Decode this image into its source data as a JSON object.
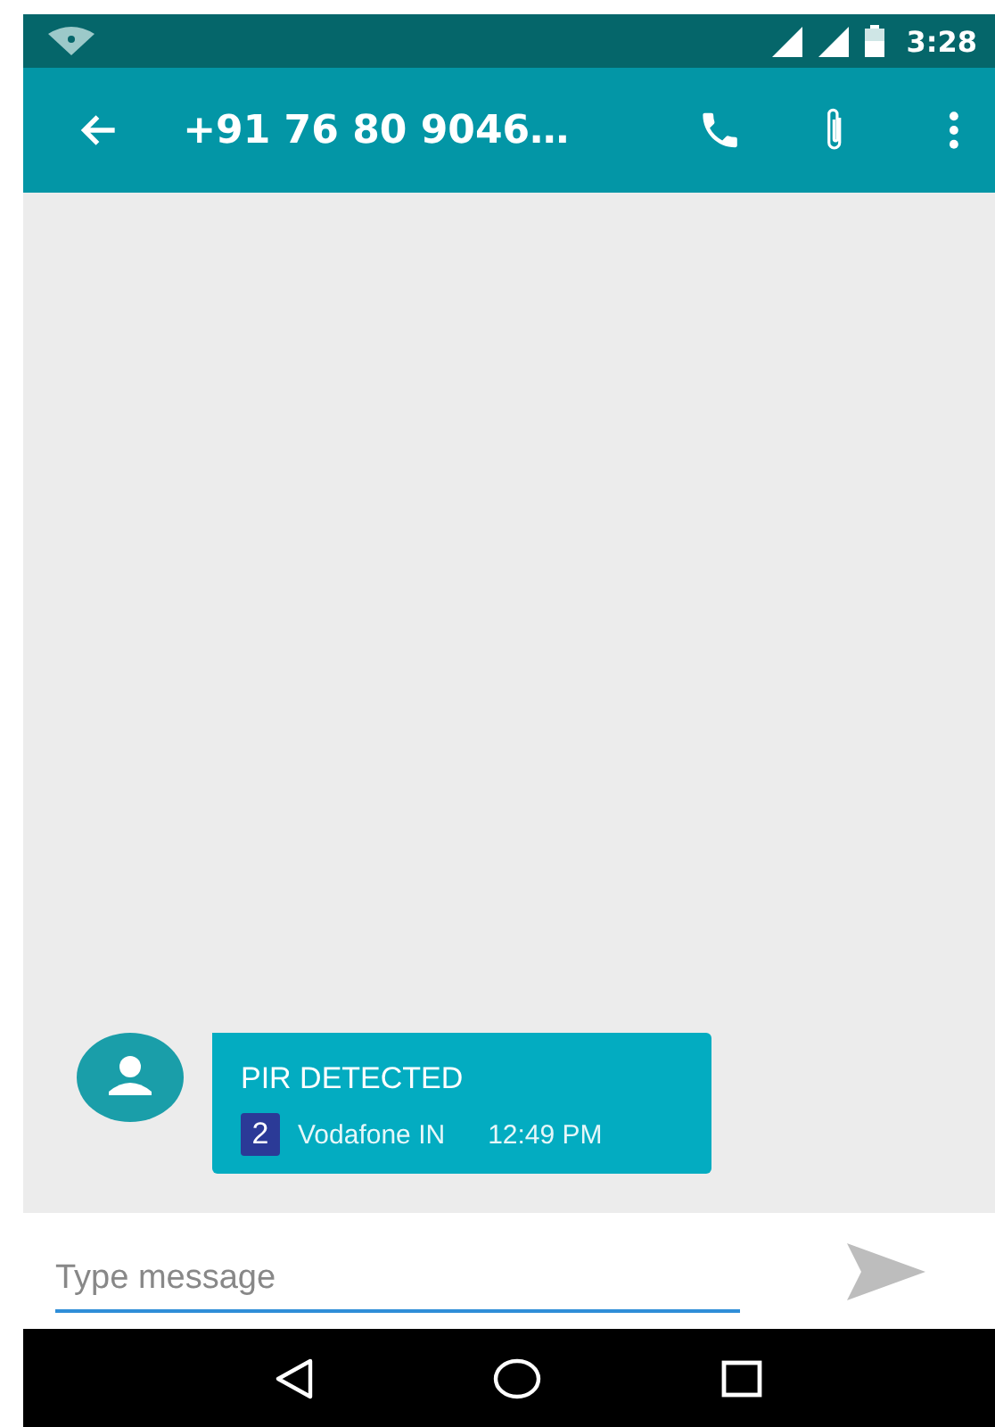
{
  "status_bar": {
    "time": "3:28"
  },
  "toolbar": {
    "title": "+91 76 80 9046…"
  },
  "messages": [
    {
      "text": "PIR DETECTED",
      "sim": "2",
      "carrier": "Vodafone IN",
      "time": "12:49 PM"
    }
  ],
  "composer": {
    "placeholder": "Type message"
  }
}
